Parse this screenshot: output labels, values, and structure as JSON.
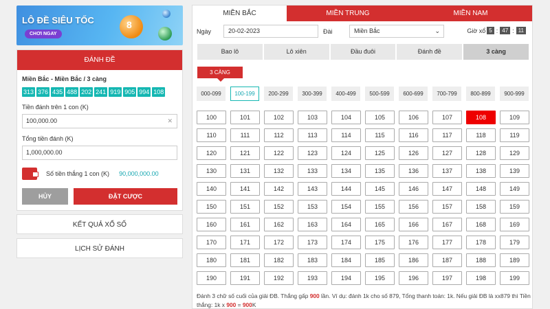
{
  "banner": {
    "title": "LÔ ĐỀ SIÊU TỐC",
    "button": "CHƠI NGAY",
    "ball_number": "8"
  },
  "panel": {
    "title": "ĐÁNH ĐỀ",
    "selection_title": "Miền Bắc - Miền Bắc / 3 càng",
    "selected_numbers": [
      "313",
      "376",
      "435",
      "488",
      "202",
      "241",
      "919",
      "905",
      "994",
      "108"
    ],
    "stake_label": "Tiền đánh trên 1 con (K)",
    "stake_value": "100,000.00",
    "total_label": "Tổng tiền đánh (K)",
    "total_value": "1,000,000.00",
    "win_label": "Số tiền thắng 1 con (K)",
    "win_value": "90,000,000.00",
    "cancel_label": "HỦY",
    "bet_label": "ĐẶT CƯỢC"
  },
  "side_links": {
    "results": "KẾT QUẢ XỔ SỐ",
    "history": "LỊCH SỬ ĐÁNH"
  },
  "regions": {
    "north": "MIỀN BẮC",
    "central": "MIỀN TRUNG",
    "south": "MIỀN NAM"
  },
  "filters": {
    "date_label": "Ngày",
    "date_value": "20-02-2023",
    "station_label": "Đài",
    "station_value": "Miền Bắc",
    "time_label": "Giờ xổ",
    "time_h": "5",
    "time_m": "47",
    "time_s": "11"
  },
  "game_tabs": [
    "Bao lô",
    "Lô xiên",
    "Đầu đuôi",
    "Đánh đề",
    "3 càng"
  ],
  "mode_tag": "3 CÀNG",
  "ranges": [
    "000-099",
    "100-199",
    "200-299",
    "300-399",
    "400-499",
    "500-599",
    "600-699",
    "700-799",
    "800-899",
    "900-999"
  ],
  "numbers": [
    "100",
    "101",
    "102",
    "103",
    "104",
    "105",
    "106",
    "107",
    "108",
    "109",
    "110",
    "111",
    "112",
    "113",
    "114",
    "115",
    "116",
    "117",
    "118",
    "119",
    "120",
    "121",
    "122",
    "123",
    "124",
    "125",
    "126",
    "127",
    "128",
    "129",
    "130",
    "131",
    "132",
    "133",
    "134",
    "135",
    "136",
    "137",
    "138",
    "139",
    "140",
    "141",
    "142",
    "143",
    "144",
    "145",
    "146",
    "147",
    "148",
    "149",
    "150",
    "151",
    "152",
    "153",
    "154",
    "155",
    "156",
    "157",
    "158",
    "159",
    "160",
    "161",
    "162",
    "163",
    "164",
    "165",
    "166",
    "167",
    "168",
    "169",
    "170",
    "171",
    "172",
    "173",
    "174",
    "175",
    "176",
    "177",
    "178",
    "179",
    "180",
    "181",
    "182",
    "183",
    "184",
    "185",
    "186",
    "187",
    "188",
    "189",
    "190",
    "191",
    "192",
    "193",
    "194",
    "195",
    "196",
    "197",
    "198",
    "199"
  ],
  "selected_number": "108",
  "note": {
    "p1": "Đánh 3 chữ số cuối của giải ĐB. Thắng gấp ",
    "b1": "900",
    "p2": " lần. Ví dụ: đánh 1k cho số 879, Tổng thanh toán: 1k. Nếu giải ĐB là xx879 thì Tiền thắng: 1k x ",
    "b2": "900",
    "p3": " = ",
    "b3": "900",
    "p4": "K"
  },
  "colors": {
    "accent": "#d32f2f",
    "teal": "#15b7b2",
    "selected_cell": "#ee0000"
  }
}
